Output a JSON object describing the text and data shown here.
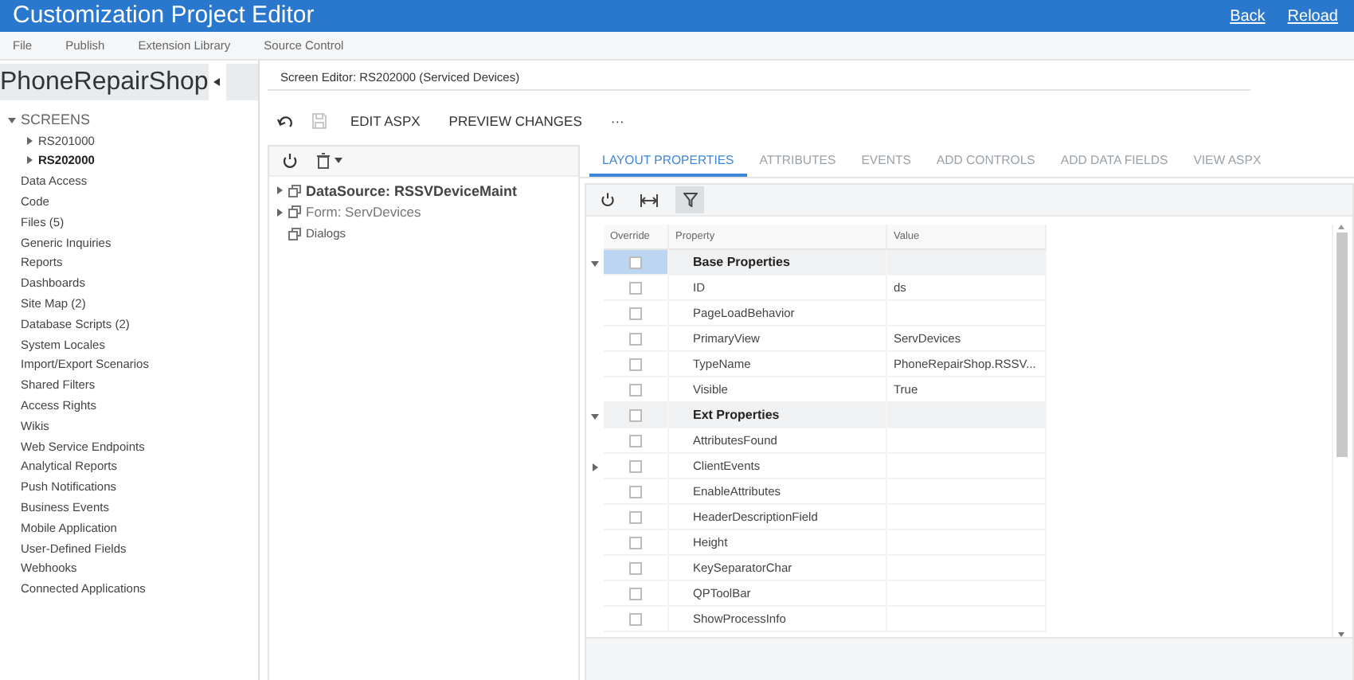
{
  "window": {
    "title": "Customization Project Editor",
    "links": [
      "Back",
      "Reload"
    ]
  },
  "menu": [
    "File",
    "Publish",
    "Extension Library",
    "Source Control"
  ],
  "sidebar": {
    "project": "PhoneRepairShop",
    "items": [
      {
        "label": "SCREENS",
        "selected": false,
        "expanded": true,
        "children": [
          {
            "label": "RS201000",
            "selected": false,
            "expanded": false
          },
          {
            "label": "RS202000",
            "selected": true,
            "expanded": false
          }
        ]
      },
      {
        "label": "Data Access",
        "selected": false
      },
      {
        "label": "Code",
        "selected": false
      },
      {
        "label": "Files (5)",
        "selected": false
      },
      {
        "label": "Generic Inquiries",
        "selected": false
      },
      {
        "label": "Reports",
        "selected": false
      },
      {
        "label": "Dashboards",
        "selected": false
      },
      {
        "label": "Site Map (2)",
        "selected": false
      },
      {
        "label": "Database Scripts (2)",
        "selected": false
      },
      {
        "label": "System Locales",
        "selected": false
      },
      {
        "label": "Import/Export Scenarios",
        "selected": false
      },
      {
        "label": "Shared Filters",
        "selected": false
      },
      {
        "label": "Access Rights",
        "selected": false
      },
      {
        "label": "Wikis",
        "selected": false
      },
      {
        "label": "Web Service Endpoints",
        "selected": false
      },
      {
        "label": "Analytical Reports",
        "selected": false
      },
      {
        "label": "Push Notifications",
        "selected": false
      },
      {
        "label": "Business Events",
        "selected": false
      },
      {
        "label": "Mobile Application",
        "selected": false
      },
      {
        "label": "User-Defined Fields",
        "selected": false
      },
      {
        "label": "Webhooks",
        "selected": false
      },
      {
        "label": "Connected Applications",
        "selected": false
      }
    ]
  },
  "editor": {
    "title": "Screen Editor: RS202000 (Serviced Devices)",
    "toolbar": {
      "undo_disabled": false,
      "save_disabled": true,
      "buttons": [
        "EDIT ASPX",
        "PREVIEW CHANGES"
      ],
      "more": "···"
    },
    "tree": [
      {
        "kind": "datasource",
        "label": "DataSource: RSSVDeviceMaint",
        "expanded": false
      },
      {
        "kind": "form",
        "label": "Form: ServDevices",
        "expanded": false
      },
      {
        "kind": "dialogs",
        "label": "Dialogs"
      }
    ],
    "tabs": [
      {
        "label": "LAYOUT PROPERTIES",
        "selected": true
      },
      {
        "label": "ATTRIBUTES",
        "selected": false
      },
      {
        "label": "EVENTS",
        "selected": false
      },
      {
        "label": "ADD CONTROLS",
        "selected": false
      },
      {
        "label": "ADD DATA FIELDS",
        "selected": false
      },
      {
        "label": "VIEW ASPX",
        "selected": false
      }
    ],
    "property_grid": {
      "filter_active": true,
      "columns": [
        "Override",
        "Property",
        "Value"
      ],
      "rows": [
        {
          "kind": "group",
          "property": "Base Properties",
          "expanded": true,
          "override": false,
          "selected": true
        },
        {
          "kind": "property",
          "property": "ID",
          "value": "ds",
          "override": false,
          "selected": false
        },
        {
          "kind": "property",
          "property": "PageLoadBehavior",
          "override": false,
          "selected": false
        },
        {
          "kind": "property",
          "property": "PrimaryView",
          "value": "ServDevices",
          "override": false,
          "selected": false
        },
        {
          "kind": "property",
          "property": "TypeName",
          "value": "PhoneRepairShop.RSSV...",
          "override": false,
          "selected": false
        },
        {
          "kind": "property",
          "property": "Visible",
          "value": "True",
          "override": false,
          "selected": false
        },
        {
          "kind": "group",
          "property": "Ext Properties",
          "expanded": true,
          "override": false,
          "selected": false
        },
        {
          "kind": "property",
          "property": "AttributesFound",
          "override": false,
          "selected": false
        },
        {
          "kind": "property",
          "property": "ClientEvents",
          "expanded": false,
          "override": false,
          "selected": false
        },
        {
          "kind": "property",
          "property": "EnableAttributes",
          "override": false,
          "selected": false
        },
        {
          "kind": "property",
          "property": "HeaderDescriptionField",
          "override": false,
          "selected": false
        },
        {
          "kind": "property",
          "property": "Height",
          "override": false,
          "selected": false
        },
        {
          "kind": "property",
          "property": "KeySeparatorChar",
          "override": false,
          "selected": false
        },
        {
          "kind": "property",
          "property": "QPToolBar",
          "override": false,
          "selected": false
        },
        {
          "kind": "property",
          "property": "ShowProcessInfo",
          "override": false,
          "selected": false
        }
      ]
    }
  }
}
